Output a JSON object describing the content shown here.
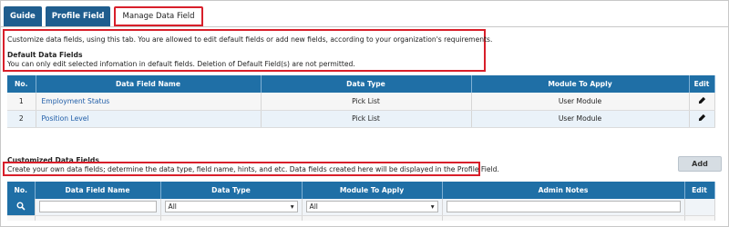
{
  "tabs": [
    "Guide",
    "Profile Field",
    "Manage Data Field"
  ],
  "intro": {
    "text": "Customize data fields, using this tab. You are allowed to edit default fields or add new fields, according to your organization's requirements.",
    "default_heading": "Default Data Fields",
    "default_note": "You can only edit selected infomation in default fields. Deletion of Default Field(s) are not permitted."
  },
  "default_table": {
    "headers": [
      "No.",
      "Data Field Name",
      "Data Type",
      "Module To Apply",
      "Edit"
    ],
    "rows": [
      {
        "no": "1",
        "name": "Employment Status",
        "type": "Pick List",
        "module": "User Module"
      },
      {
        "no": "2",
        "name": "Position Level",
        "type": "Pick List",
        "module": "User Module"
      }
    ]
  },
  "customized": {
    "heading": "Customized Data Fields",
    "note": "Create your own data fields; determine the data type, field name, hints, and etc. Data fields created here will be displayed in the Profile Field.",
    "add_label": "Add",
    "headers": [
      "No.",
      "Data Field Name",
      "Data Type",
      "Module To Apply",
      "Admin Notes",
      "Edit"
    ],
    "filter_type": "All",
    "filter_module": "All"
  },
  "colors": {
    "header_blue": "#1f6fa6",
    "tab_blue": "#1f5d8e",
    "highlight_red": "#d81f2a",
    "link_blue": "#1f5da8"
  }
}
